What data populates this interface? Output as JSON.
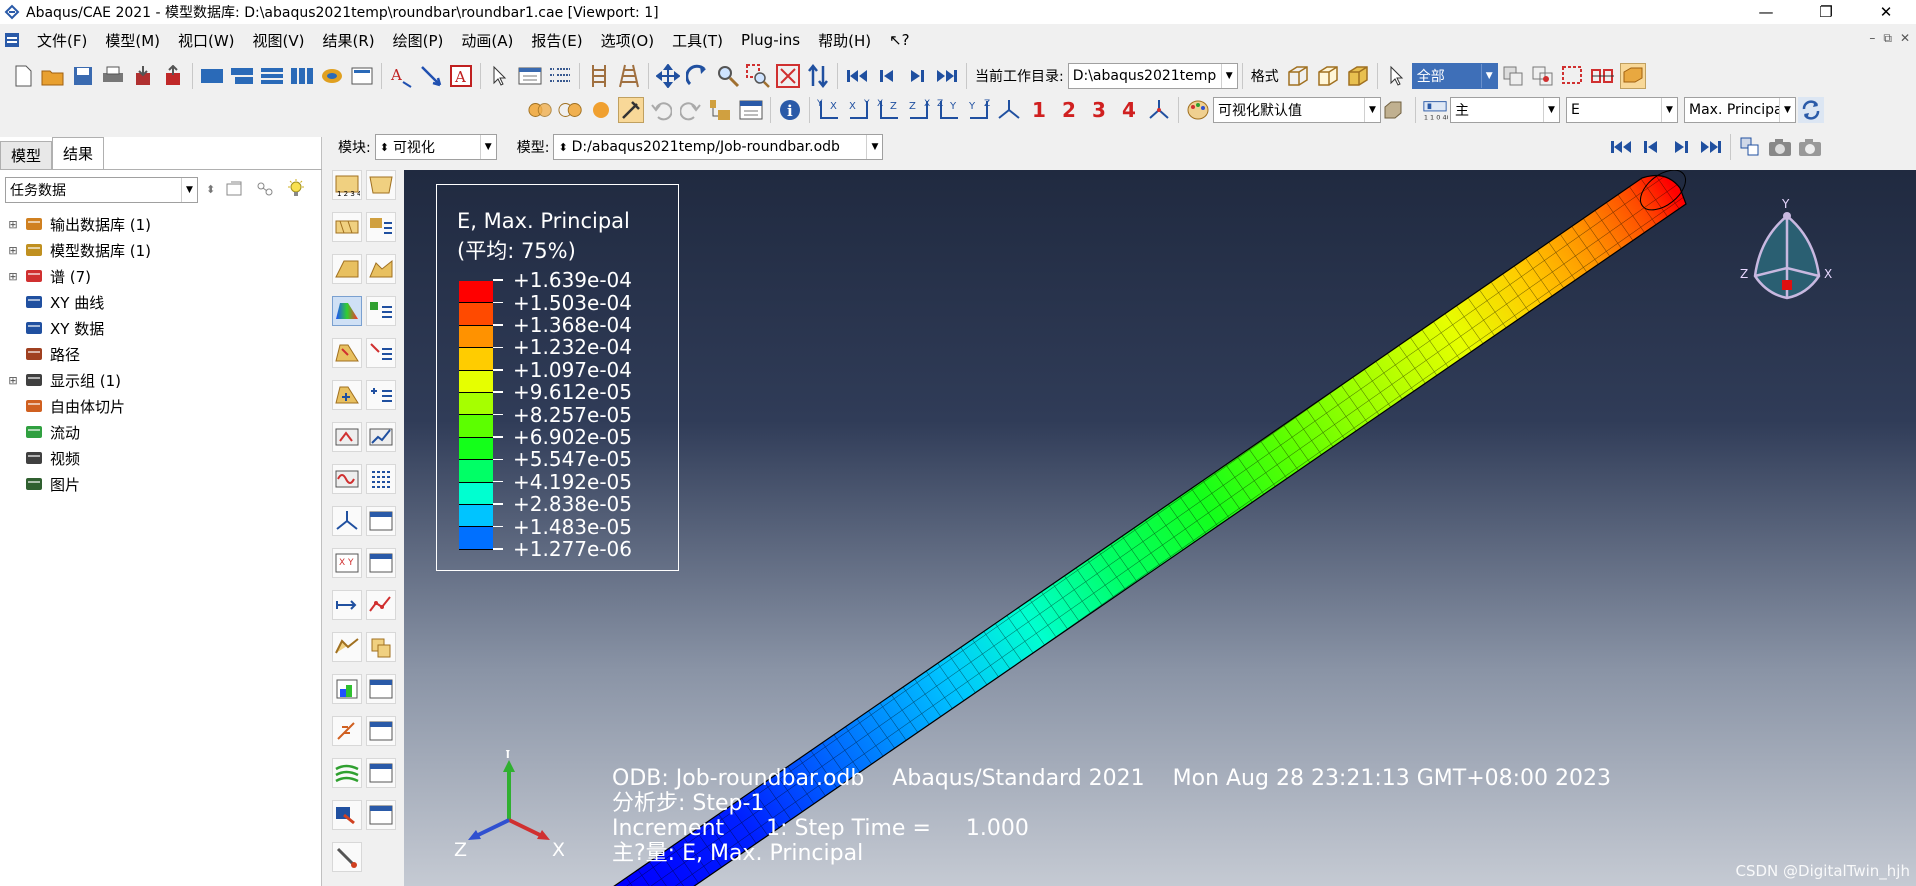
{
  "window": {
    "title": "Abaqus/CAE 2021 - 模型数据库: D:\\abaqus2021temp\\roundbar\\roundbar1.cae [Viewport: 1]",
    "min": "—",
    "max": "❐",
    "close": "✕"
  },
  "menu": {
    "items": [
      "文件(F)",
      "模型(M)",
      "视口(W)",
      "视图(V)",
      "结果(R)",
      "绘图(P)",
      "动画(A)",
      "报告(E)",
      "选项(O)",
      "工具(T)",
      "Plug-ins",
      "帮助(H)",
      "↖?"
    ],
    "mdi": [
      "–",
      "⧉",
      "✕"
    ]
  },
  "toolbar1": {
    "workdir_label": "当前工作目录:",
    "workdir_value": "D:\\abaqus2021temp",
    "format_label": "格式",
    "render_select": "全部"
  },
  "toolbar2": {
    "numbers": [
      "1",
      "2",
      "3",
      "4"
    ],
    "vis_defaults": "可视化默认值",
    "primary": "主",
    "variable": "E",
    "invariant": "Max. Principal"
  },
  "context": {
    "module_label": "模块:",
    "module_value": "可视化",
    "model_label": "模型:",
    "model_value": "D:/abaqus2021temp/Job-roundbar.odb"
  },
  "tabs": [
    "模型",
    "结果"
  ],
  "task_combo": "任务数据",
  "tree": [
    {
      "pm": "⊞",
      "icon": "odb-icon",
      "label": "输出数据库 (1)",
      "color": "#d08020"
    },
    {
      "pm": "⊞",
      "icon": "model-db-icon",
      "label": "模型数据库 (1)",
      "color": "#c09020"
    },
    {
      "pm": "⊞",
      "icon": "spectrum-icon",
      "label": "谱 (7)",
      "color": "#d03030"
    },
    {
      "pm": "",
      "icon": "xy-curve-icon",
      "label": "XY 曲线",
      "color": "#2050a0"
    },
    {
      "pm": "",
      "icon": "xy-data-icon",
      "label": "XY 数据",
      "color": "#2050a0"
    },
    {
      "pm": "",
      "icon": "path-icon",
      "label": "路径",
      "color": "#a04020"
    },
    {
      "pm": "⊞",
      "icon": "display-group-icon",
      "label": "显示组 (1)",
      "color": "#404040"
    },
    {
      "pm": "",
      "icon": "free-body-icon",
      "label": "自由体切片",
      "color": "#d06020"
    },
    {
      "pm": "",
      "icon": "stream-icon",
      "label": "流动",
      "color": "#30a040"
    },
    {
      "pm": "",
      "icon": "movie-icon",
      "label": "视频",
      "color": "#404040"
    },
    {
      "pm": "",
      "icon": "image-icon",
      "label": "图片",
      "color": "#306030"
    }
  ],
  "legend": {
    "title": "E, Max. Principal",
    "subtitle": "(平均: 75%)",
    "values": [
      "+1.639e-04",
      "+1.503e-04",
      "+1.368e-04",
      "+1.232e-04",
      "+1.097e-04",
      "+9.612e-05",
      "+8.257e-05",
      "+6.902e-05",
      "+5.547e-05",
      "+4.192e-05",
      "+2.838e-05",
      "+1.483e-05",
      "+1.277e-06"
    ],
    "colors": [
      "#ff0000",
      "#ff4a00",
      "#ff9200",
      "#ffcc00",
      "#e6ff00",
      "#a6ff00",
      "#5cff00",
      "#14ff1a",
      "#00ff66",
      "#00ffd0",
      "#00c4ff",
      "#0070ff",
      "#0000ff"
    ]
  },
  "info": {
    "line1": "ODB: Job-roundbar.odb    Abaqus/Standard 2021    Mon Aug 28 23:21:13 GMT+08:00 2023",
    "line2": "分析步: Step-1",
    "line3": "Increment      1: Step Time =     1.000",
    "line4": "主?量: E, Max. Principal"
  },
  "triad": {
    "y": "Y",
    "x": "X",
    "z": "Z"
  },
  "watermark": "CSDN @DigitalTwin_hjh",
  "colors": {
    "viewport_top": "#202a40",
    "viewport_bottom": "#c5cad3"
  }
}
